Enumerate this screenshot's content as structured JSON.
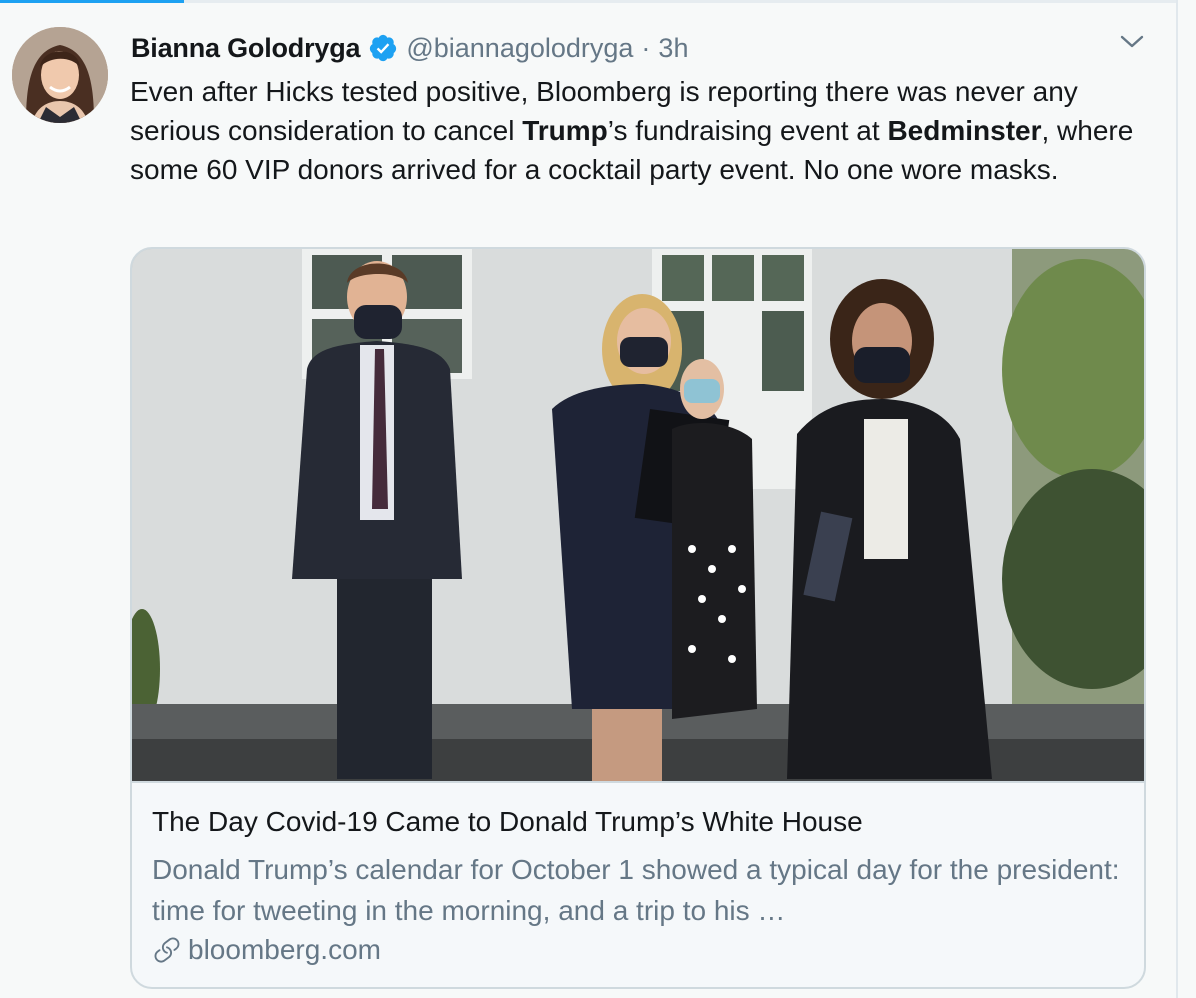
{
  "tweet": {
    "author": {
      "display_name": "Bianna Golodryga",
      "handle": "@biannagolodryga",
      "verified": true,
      "avatar_icon": "profile-photo"
    },
    "separator": "·",
    "time": "3h",
    "menu_icon": "chevron-down-icon",
    "text": {
      "part1": "Even after Hicks tested positive, Bloomberg is reporting there was never any serious consideration to cancel ",
      "bold1": "Trump",
      "part2": "’s fundraising event at ",
      "bold2": "Bedminster",
      "part3": ", where some 60 VIP donors arrived for a cocktail party event. No one wore masks."
    },
    "card": {
      "image_icon": "article-photo",
      "title": "The Day Covid-19 Came to Donald Trump’s White House",
      "description": "Donald Trump’s calendar for October 1 showed a typical day for the president: time for tweeting in the morning, and a trip to his …",
      "domain": "bloomberg.com",
      "link_icon": "link-icon"
    }
  },
  "colors": {
    "accent": "#1da1f2",
    "secondary_text": "#657786",
    "primary_text": "#14171a",
    "background": "#f7f9f9",
    "border": "#cfd9de"
  }
}
